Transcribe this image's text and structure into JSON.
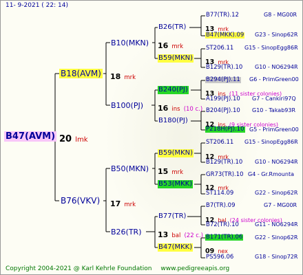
{
  "header": {
    "date": "11-  9-2021 ( 22: 14)"
  },
  "footer": {
    "copyright": "Copyright 2004-2021 @ Karl Kehrle Foundation",
    "site": "www.pedigreeapis.org"
  },
  "gen0": {
    "name": "B47(AVM)",
    "count": "20",
    "label": "lmk"
  },
  "gen1": [
    {
      "name": "B18(AVM)",
      "count": "18",
      "label": "mrk"
    },
    {
      "name": "B76(VKV)",
      "count": "17",
      "label": "mrk"
    }
  ],
  "gen2": [
    {
      "name": "B10(MKN)",
      "count": "16",
      "label": "mrk"
    },
    {
      "name": "B100(PJ)",
      "count": "16",
      "label": "ins",
      "note": "(10 c.)"
    },
    {
      "name": "B50(MKN)",
      "count": "15",
      "label": "mrk"
    },
    {
      "name": "B26(TR)",
      "count": "13",
      "label": "bal",
      "note": "(22 c.)"
    }
  ],
  "gen3": [
    {
      "name": "B26(TR)",
      "count": "13",
      "label": "mrk"
    },
    {
      "name": "B59(MKN)",
      "count": "13",
      "label": "mrk"
    },
    {
      "name": "B240(PJ)",
      "count": "13",
      "label": "ins",
      "note": "(11 sister colonies)"
    },
    {
      "name": "B180(PJ)",
      "count": "12",
      "label": "ins",
      "note": "(9 sister colonies)"
    },
    {
      "name": "B59(MKN)",
      "count": "12",
      "label": "mrk"
    },
    {
      "name": "B53(MKK)",
      "count": "12",
      "label": "mrk"
    },
    {
      "name": "B77(TR)",
      "count": "12",
      "label": "bal",
      "note": "(24 sister colonies)"
    },
    {
      "name": "B47(MKK)",
      "count": "09",
      "label": "nex"
    }
  ],
  "gen4": [
    {
      "name": "B77(TR).12",
      "info": "G8 - MG00R"
    },
    {
      "name": "B47(MKK).09",
      "info": "G23 - Sinop62R"
    },
    {
      "name": "ST206.11",
      "info": "G15 - SinopEgg86R"
    },
    {
      "name": "B129(TR).10",
      "info": "G10 - NO6294R"
    },
    {
      "name": "B294(PJ).11",
      "info": "G6 - PrimGreen00"
    },
    {
      "name": "A199(PJ).10",
      "info": "G7 - Cankiri97Q"
    },
    {
      "name": "B204(PJ).10",
      "info": "G10 - Takab93R"
    },
    {
      "name": "P218H(PJ).10",
      "info": "G5 - PrimGreen00"
    },
    {
      "name": "ST206.11",
      "info": "G15 - SinopEgg86R"
    },
    {
      "name": "B129(TR).10",
      "info": "G10 - NO6294R"
    },
    {
      "name": "GR73(TR).10",
      "info": "G4 - Gr.Rmounta"
    },
    {
      "name": "ST114.09",
      "info": "G22 - Sinop62R"
    },
    {
      "name": "B7(TR).09",
      "info": "G7 - MG00R"
    },
    {
      "name": "B72(TR).10",
      "info": "G11 - NO6294R"
    },
    {
      "name": "B171(TR).06",
      "info": "G22 - Sinop62R"
    },
    {
      "name": "PS596.06",
      "info": "G18 - Sinop72R"
    }
  ]
}
